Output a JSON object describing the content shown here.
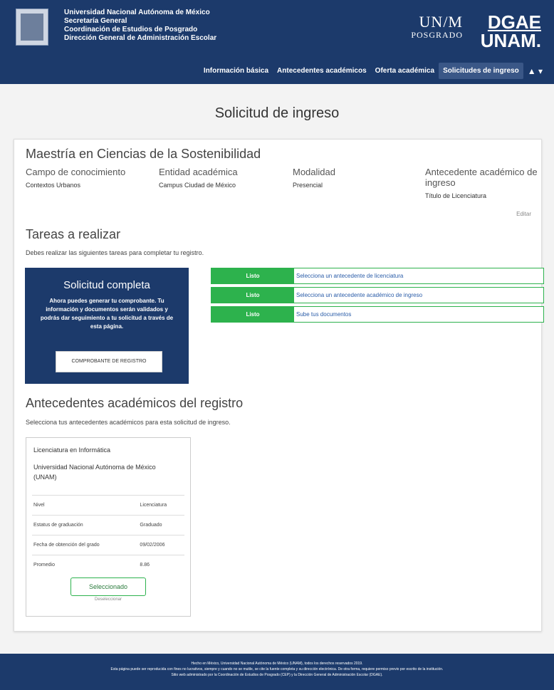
{
  "header": {
    "institution_lines": [
      "Universidad Nacional Autónoma de México",
      "Secretaría General",
      "Coordinación de Estudios de Posgrado",
      "Dirección General de Administración Escolar"
    ],
    "logo_unam_text": "UN/M",
    "logo_posgrado_text": "POSGRADO",
    "logo_dgae_text": "DGAE",
    "logo_unam2_text": "UNAM.",
    "nav": [
      "Información básica",
      "Antecedentes académicos",
      "Oferta académica",
      "Solicitudes de ingreso"
    ],
    "user_menu_symbol": "▲ ▾"
  },
  "page_title": "Solicitud de ingreso",
  "program": {
    "title": "Maestría en Ciencias de la Sostenibilidad",
    "fields": [
      {
        "label": "Campo de conocimiento",
        "value": "Contextos Urbanos"
      },
      {
        "label": "Entidad académica",
        "value": "Campus Ciudad de México"
      },
      {
        "label": "Modalidad",
        "value": "Presencial"
      },
      {
        "label": "Antecedente académico de ingreso",
        "value": "Título de Licenciatura"
      }
    ],
    "edit_label": "Editar"
  },
  "tasks": {
    "title": "Tareas a realizar",
    "description": "Debes realizar las siguientes tareas para completar tu registro.",
    "complete": {
      "title": "Solicitud completa",
      "text": "Ahora puedes generar tu comprobante. Tu información y documentos serán validados y podrás dar seguimiento a tu solicitud a través de esta página.",
      "button": "COMPROBANTE DE REGISTRO"
    },
    "items": [
      {
        "badge": "Listo",
        "label": "Selecciona un antecedente de licenciatura"
      },
      {
        "badge": "Listo",
        "label": "Selecciona un antecedente académico de ingreso"
      },
      {
        "badge": "Listo",
        "label": "Sube tus documentos"
      }
    ],
    "status_color": "#2db24d"
  },
  "antecedentes": {
    "title": "Antecedentes académicos del registro",
    "description": "Selecciona tus antecedentes académicos para esta solicitud de ingreso.",
    "card": {
      "degree": "Licenciatura en Informática",
      "institution": "Universidad Nacional Autónoma de México (UNAM)",
      "rows": [
        {
          "label": "Nivel",
          "value": "Licenciatura"
        },
        {
          "label": "Estatus de graduación",
          "value": "Graduado"
        },
        {
          "label": "Fecha de obtención del grado",
          "value": "09/02/2006"
        },
        {
          "label": "Promedio",
          "value": "8.86"
        }
      ],
      "button": "Seleccionado",
      "sub": "Deseleccionar"
    }
  },
  "footer": {
    "lines": [
      "Hecho en México, Universidad Nacional Autónoma de México (UNAM), todos los derechos reservados 2019.",
      "Esta página puede ser reproducida con fines no lucrativos, siempre y cuando no se mutile, se cite la fuente completa y su dirección electrónica. De otra forma, requiere permiso previo por escrito de la institución.",
      "Sitio web administrado por la Coordinación de Estudios de Posgrado (CEP) y la Dirección General de Administración Escolar (DGAE)."
    ]
  },
  "colors": {
    "brand": "#1c3a6b",
    "success": "#2db24d",
    "link": "#2a5ca8"
  }
}
